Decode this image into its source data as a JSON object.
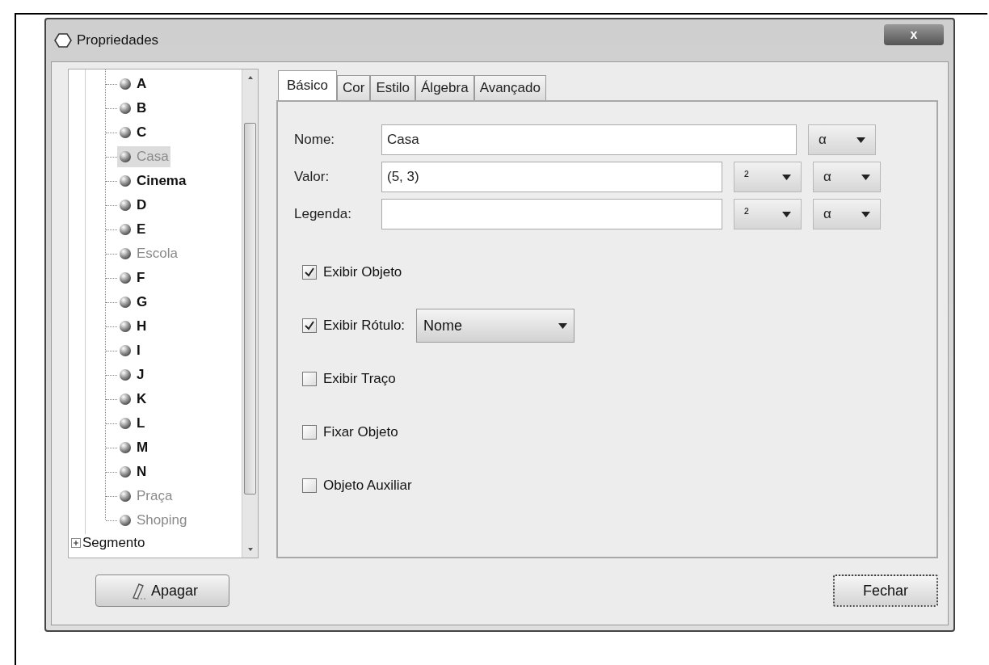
{
  "window": {
    "title": "Propriedades",
    "close": "x"
  },
  "tree": {
    "items": [
      {
        "label": "A",
        "selected": false,
        "hidden": false
      },
      {
        "label": "B",
        "selected": false,
        "hidden": false
      },
      {
        "label": "C",
        "selected": false,
        "hidden": false
      },
      {
        "label": "Casa",
        "selected": true,
        "hidden": true
      },
      {
        "label": "Cinema",
        "selected": false,
        "hidden": false
      },
      {
        "label": "D",
        "selected": false,
        "hidden": false
      },
      {
        "label": "E",
        "selected": false,
        "hidden": false
      },
      {
        "label": "Escola",
        "selected": false,
        "hidden": true
      },
      {
        "label": "F",
        "selected": false,
        "hidden": false
      },
      {
        "label": "G",
        "selected": false,
        "hidden": false
      },
      {
        "label": "H",
        "selected": false,
        "hidden": false
      },
      {
        "label": "I",
        "selected": false,
        "hidden": false
      },
      {
        "label": "J",
        "selected": false,
        "hidden": false
      },
      {
        "label": "K",
        "selected": false,
        "hidden": false
      },
      {
        "label": "L",
        "selected": false,
        "hidden": false
      },
      {
        "label": "M",
        "selected": false,
        "hidden": false
      },
      {
        "label": "N",
        "selected": false,
        "hidden": false
      },
      {
        "label": "Praça",
        "selected": false,
        "hidden": true
      },
      {
        "label": "Shoping",
        "selected": false,
        "hidden": true
      }
    ],
    "groups": [
      {
        "label": "Segmento",
        "expanded": false
      }
    ]
  },
  "tabs": [
    {
      "label": "Básico",
      "selected": true
    },
    {
      "label": "Cor",
      "selected": false
    },
    {
      "label": "Estilo",
      "selected": false
    },
    {
      "label": "Álgebra",
      "selected": false
    },
    {
      "label": "Avançado",
      "selected": false
    }
  ],
  "fields": [
    {
      "label": "Nome:",
      "value": "Casa",
      "dropdowns": [
        "α"
      ]
    },
    {
      "label": "Valor:",
      "value": "(5, 3)",
      "dropdowns": [
        "²",
        "α"
      ]
    },
    {
      "label": "Legenda:",
      "dropdowns": [
        "²",
        "α"
      ]
    }
  ],
  "checkboxes": [
    {
      "label": "Exibir Objeto",
      "checked": true
    },
    {
      "label": "Exibir Rótulo:",
      "checked": true,
      "dropdown": "Nome"
    },
    {
      "label": "Exibir Traço",
      "checked": false
    },
    {
      "label": "Fixar Objeto",
      "checked": false
    },
    {
      "label": "Objeto Auxiliar",
      "checked": false
    }
  ],
  "buttons": {
    "delete": "Apagar",
    "close": "Fechar"
  }
}
